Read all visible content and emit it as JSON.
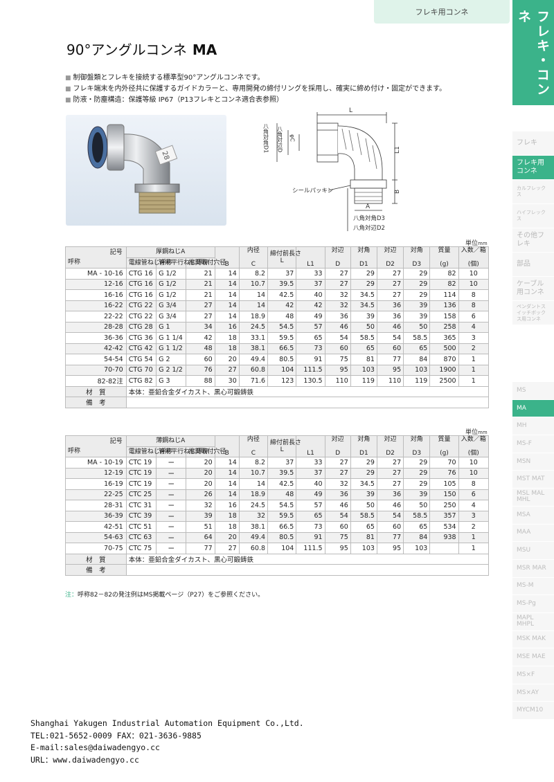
{
  "header": {
    "category_tab": "フレキ用コンネ",
    "side_title": "フレキ・コンネ"
  },
  "side_nav_main": [
    {
      "label": "フレキ",
      "active": false
    },
    {
      "label": "フレキ用コンネ",
      "active": true
    },
    {
      "label": "カルフレックス",
      "active": false,
      "small": true
    },
    {
      "label": "ハイフレックス",
      "active": false,
      "small": true
    },
    {
      "label": "その他フレキ",
      "active": false
    },
    {
      "label": "部品",
      "active": false
    },
    {
      "label": "ケーブル用コンネ",
      "active": false
    },
    {
      "label": "ペンダントスイッチボックス用コンネ",
      "active": false,
      "small": true
    }
  ],
  "side_nav_series": [
    {
      "label": "MS",
      "active": false
    },
    {
      "label": "MA",
      "active": true
    },
    {
      "label": "MH",
      "active": false
    },
    {
      "label": "MS-F",
      "active": false
    },
    {
      "label": "MSN",
      "active": false
    },
    {
      "label": "MST MAT",
      "active": false
    },
    {
      "label": "MSL MAL MHL",
      "active": false
    },
    {
      "label": "MSA",
      "active": false
    },
    {
      "label": "MAA",
      "active": false
    },
    {
      "label": "MSU",
      "active": false
    },
    {
      "label": "MSR MAR",
      "active": false
    },
    {
      "label": "MS-M",
      "active": false
    },
    {
      "label": "MS-Pg",
      "active": false
    },
    {
      "label": "MAPL MHPL",
      "active": false
    },
    {
      "label": "MSK MAK",
      "active": false
    },
    {
      "label": "MSE MAE",
      "active": false
    },
    {
      "label": "MS×F",
      "active": false
    },
    {
      "label": "MS×AY",
      "active": false
    },
    {
      "label": "MYCM10",
      "active": false
    }
  ],
  "title": {
    "jp": "90°アングルコンネ",
    "code": "MA"
  },
  "bullets": [
    "制御盤類とフレキを接続する標準型90°アングルコンネです。",
    "フレキ端末を内外径共に保護するガイドカラーと、専用開発の締付リングを採用し、確実に締め付け・固定ができます。",
    "防液・防塵構造：保護等級 IP67（P13フレキとコンネ適合表参照）"
  ],
  "drawing_labels": {
    "L": "L",
    "L1": "L1",
    "B": "B",
    "A": "A",
    "D1": "八角対角D1",
    "D": "八角対辺D",
    "C": "φC",
    "seal": "シールパッキン",
    "D3": "八角対角D3",
    "D2": "八角対辺D2"
  },
  "unit_label": "単位",
  "unit_mm": "mm",
  "table_headers": {
    "kigou": "記号",
    "yobi": "呼称",
    "thick_group": "厚鋼ねじA",
    "thin_group": "薄鋼ねじA",
    "denki": "電線管ねじ呼称",
    "kanyou": "管用平行ねじ呼称",
    "suishou": "推奨取付穴径",
    "B": "B",
    "naikei": "内径",
    "C": "C",
    "shimetsuke": "締付前長さ",
    "L": "L",
    "L1": "L1",
    "taihen": "対辺",
    "D": "D",
    "taikaku": "対角",
    "D1": "D1",
    "D2": "D2",
    "D3": "D3",
    "shitsuryou": "質量",
    "g": "(g)",
    "irisu": "入数／箱",
    "ko": "(個)"
  },
  "table1_rows": [
    [
      "MA -  10-16",
      "CTG 16",
      "G 1/2",
      "21",
      "14",
      "8.2",
      "37",
      "33",
      "27",
      "29",
      "27",
      "29",
      "82",
      "10"
    ],
    [
      "12-16",
      "CTG 16",
      "G 1/2",
      "21",
      "14",
      "10.7",
      "39.5",
      "37",
      "27",
      "29",
      "27",
      "29",
      "82",
      "10"
    ],
    [
      "16-16",
      "CTG 16",
      "G 1/2",
      "21",
      "14",
      "14",
      "42.5",
      "40",
      "32",
      "34.5",
      "27",
      "29",
      "114",
      "8"
    ],
    [
      "16-22",
      "CTG 22",
      "G 3/4",
      "27",
      "14",
      "14",
      "42",
      "42",
      "32",
      "34.5",
      "36",
      "39",
      "136",
      "8"
    ],
    [
      "22-22",
      "CTG 22",
      "G 3/4",
      "27",
      "14",
      "18.9",
      "48",
      "49",
      "36",
      "39",
      "36",
      "39",
      "158",
      "6"
    ],
    [
      "28-28",
      "CTG 28",
      "G 1",
      "34",
      "16",
      "24.5",
      "54.5",
      "57",
      "46",
      "50",
      "46",
      "50",
      "258",
      "4"
    ],
    [
      "36-36",
      "CTG 36",
      "G 1 1/4",
      "42",
      "18",
      "33.1",
      "59.5",
      "65",
      "54",
      "58.5",
      "54",
      "58.5",
      "365",
      "3"
    ],
    [
      "42-42",
      "CTG 42",
      "G 1 1/2",
      "48",
      "18",
      "38.1",
      "66.5",
      "73",
      "60",
      "65",
      "60",
      "65",
      "500",
      "2"
    ],
    [
      "54-54",
      "CTG 54",
      "G 2",
      "60",
      "20",
      "49.4",
      "80.5",
      "91",
      "75",
      "81",
      "77",
      "84",
      "870",
      "1"
    ],
    [
      "70-70",
      "CTG 70",
      "G 2 1/2",
      "76",
      "27",
      "60.8",
      "104",
      "111.5",
      "95",
      "103",
      "95",
      "103",
      "1900",
      "1"
    ],
    [
      "82-82注",
      "CTG 82",
      "G 3",
      "88",
      "30",
      "71.6",
      "123",
      "130.5",
      "110",
      "119",
      "110",
      "119",
      "2500",
      "1"
    ]
  ],
  "table2_rows": [
    [
      "MA -  10-19",
      "CTC 19",
      "ー",
      "20",
      "14",
      "8.2",
      "37",
      "33",
      "27",
      "29",
      "27",
      "29",
      "70",
      "10"
    ],
    [
      "12-19",
      "CTC 19",
      "ー",
      "20",
      "14",
      "10.7",
      "39.5",
      "37",
      "27",
      "29",
      "27",
      "29",
      "76",
      "10"
    ],
    [
      "16-19",
      "CTC 19",
      "ー",
      "20",
      "14",
      "14",
      "42.5",
      "40",
      "32",
      "34.5",
      "27",
      "29",
      "105",
      "8"
    ],
    [
      "22-25",
      "CTC 25",
      "ー",
      "26",
      "14",
      "18.9",
      "48",
      "49",
      "36",
      "39",
      "36",
      "39",
      "150",
      "6"
    ],
    [
      "28-31",
      "CTC 31",
      "ー",
      "32",
      "16",
      "24.5",
      "54.5",
      "57",
      "46",
      "50",
      "46",
      "50",
      "250",
      "4"
    ],
    [
      "36-39",
      "CTC 39",
      "ー",
      "39",
      "18",
      "32",
      "59.5",
      "65",
      "54",
      "58.5",
      "54",
      "58.5",
      "357",
      "3"
    ],
    [
      "42-51",
      "CTC 51",
      "ー",
      "51",
      "18",
      "38.1",
      "66.5",
      "73",
      "60",
      "65",
      "60",
      "65",
      "534",
      "2"
    ],
    [
      "54-63",
      "CTC 63",
      "ー",
      "64",
      "20",
      "49.4",
      "80.5",
      "91",
      "75",
      "81",
      "77",
      "84",
      "938",
      "1"
    ],
    [
      "70-75",
      "CTC 75",
      "ー",
      "77",
      "27",
      "60.8",
      "104",
      "111.5",
      "95",
      "103",
      "95",
      "103",
      "",
      "1"
    ]
  ],
  "material": {
    "label": "材　質",
    "value": "本体：亜鉛合金ダイカスト、黒心可鍛鋳鉄"
  },
  "remarks": {
    "label": "備　考",
    "value": ""
  },
  "note": {
    "mark": "注：",
    "text": "呼称82－82の発注例はMS掲載ページ（P27）をご参照ください。"
  },
  "footer": {
    "company": "Shanghai Yakugen Industrial Automation Equipment Co.,Ltd.",
    "tel": "TEL:021-5652-0009   FAX：021-3636-9885",
    "email": "E-mail:sales@daiwadengyo.cc",
    "url": "URL：www.daiwadengyo.cc"
  }
}
